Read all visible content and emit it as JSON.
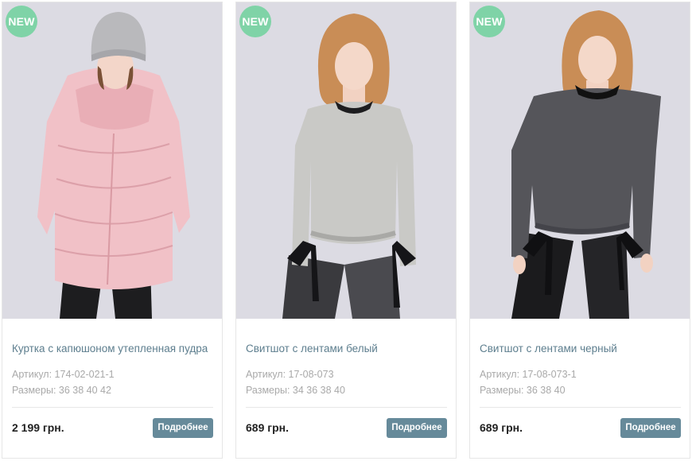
{
  "products": [
    {
      "badge": "NEW",
      "title": "Куртка с капюшоном утепленная пудра",
      "sku": "Артикул: 174-02-021-1",
      "sizes": "Размеры: 36 38 40 42",
      "price": "2 199 грн.",
      "button": "Подробнее",
      "image": "model-pink-puffer-jacket"
    },
    {
      "badge": "NEW",
      "title": "Свитшот с лентами белый",
      "sku": "Артикул: 17-08-073",
      "sizes": "Размеры: 34 36 38 40",
      "price": "689 грн.",
      "button": "Подробнее",
      "image": "model-light-grey-sweatshirt"
    },
    {
      "badge": "NEW",
      "title": "Свитшот с лентами черный",
      "sku": "Артикул: 17-08-073-1",
      "sizes": "Размеры: 36 38 40",
      "price": "689 грн.",
      "button": "Подробнее",
      "image": "model-dark-grey-sweatshirt"
    }
  ],
  "colors": {
    "badge": "#7fd3a7",
    "title": "#5d7e8e",
    "button": "#668a9a",
    "meta": "#a9a9a9",
    "photo_background": "#dcdbe3"
  }
}
